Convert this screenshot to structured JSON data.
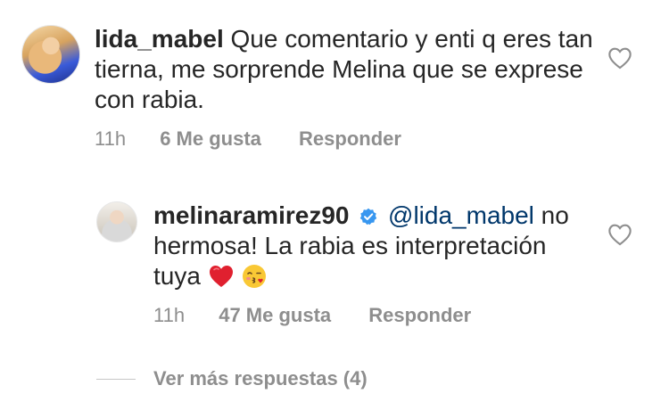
{
  "comments": [
    {
      "username": "lida_mabel",
      "text": "Que comentario y enti q eres tan tierna, me sorprende Melina que se exprese con rabia.",
      "time": "11h",
      "likes": "6 Me gusta",
      "reply_label": "Responder"
    },
    {
      "username": "melinaramirez90",
      "verified": true,
      "mention": "@lida_mabel",
      "text": " no hermosa! La rabia es interpretación tuya ",
      "emojis": [
        "heart-emoji",
        "kiss-emoji"
      ],
      "time": "11h",
      "likes": "47 Me gusta",
      "reply_label": "Responder"
    }
  ],
  "view_more_label": "Ver más respuestas (4)",
  "colors": {
    "text": "#262626",
    "meta": "#8e8e8e",
    "mention": "#00376b",
    "verified": "#3897f0"
  }
}
